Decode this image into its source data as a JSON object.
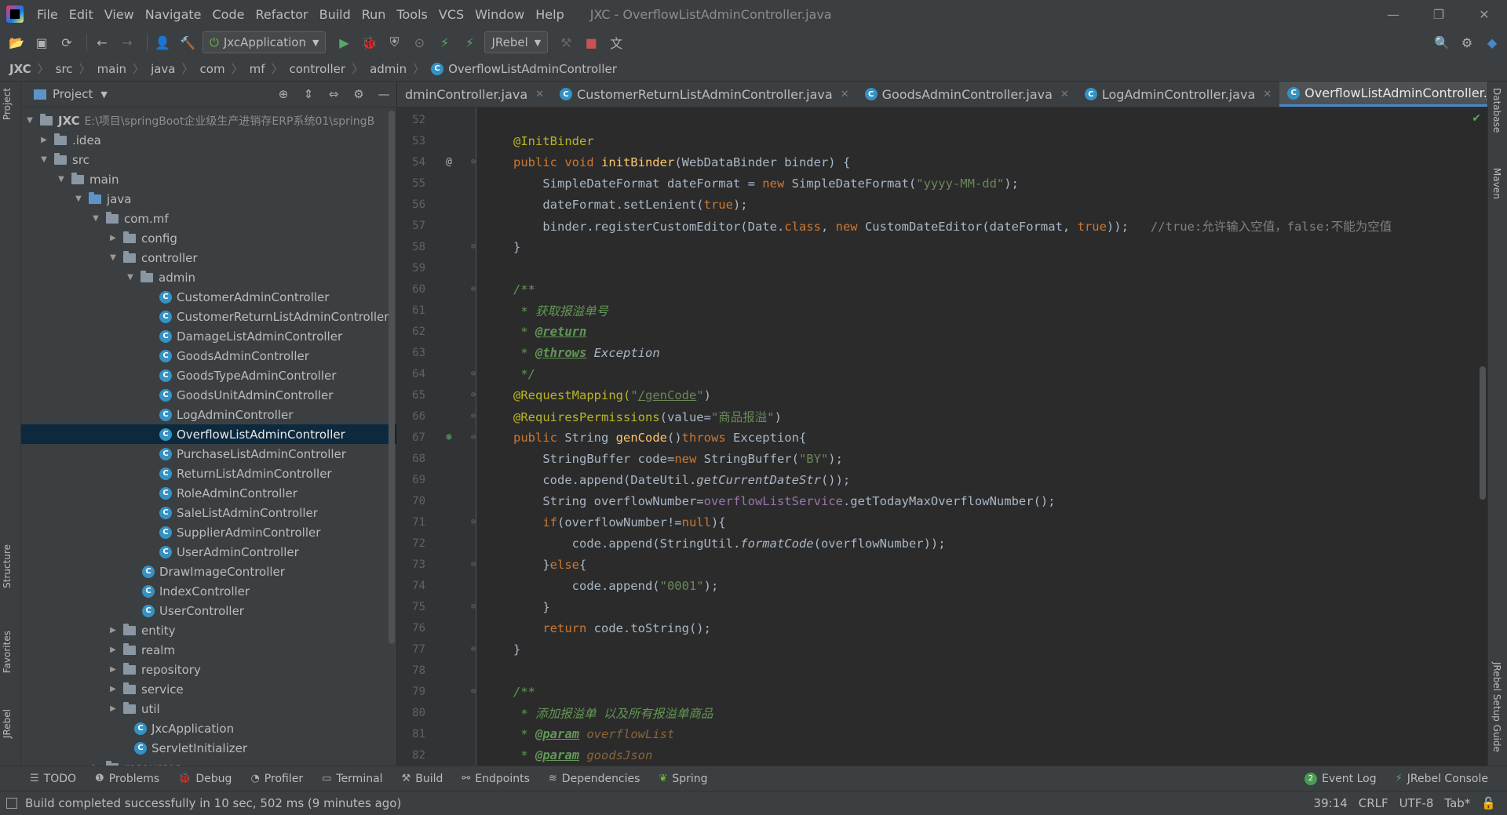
{
  "menu": [
    "File",
    "Edit",
    "View",
    "Navigate",
    "Code",
    "Refactor",
    "Build",
    "Run",
    "Tools",
    "VCS",
    "Window",
    "Help"
  ],
  "window_title": "JXC - OverflowListAdminController.java",
  "toolbar": {
    "run_config": "JxcApplication",
    "jrebel_label": "JRebel"
  },
  "breadcrumb": [
    "JXC",
    "src",
    "main",
    "java",
    "com",
    "mf",
    "controller",
    "admin",
    "OverflowListAdminController"
  ],
  "project": {
    "header": "Project",
    "root_name": "JXC",
    "root_path": "E:\\项目\\springBoot企业级生产进销存ERP系统01\\springB",
    "tree": [
      {
        "label": ".idea"
      },
      {
        "label": "src"
      },
      {
        "label": "main"
      },
      {
        "label": "java"
      },
      {
        "label": "com.mf"
      },
      {
        "label": "config"
      },
      {
        "label": "controller"
      },
      {
        "label": "admin"
      },
      {
        "label": "CustomerAdminController"
      },
      {
        "label": "CustomerReturnListAdminController"
      },
      {
        "label": "DamageListAdminController"
      },
      {
        "label": "GoodsAdminController"
      },
      {
        "label": "GoodsTypeAdminController"
      },
      {
        "label": "GoodsUnitAdminController"
      },
      {
        "label": "LogAdminController"
      },
      {
        "label": "OverflowListAdminController"
      },
      {
        "label": "PurchaseListAdminController"
      },
      {
        "label": "ReturnListAdminController"
      },
      {
        "label": "RoleAdminController"
      },
      {
        "label": "SaleListAdminController"
      },
      {
        "label": "SupplierAdminController"
      },
      {
        "label": "UserAdminController"
      },
      {
        "label": "DrawImageController"
      },
      {
        "label": "IndexController"
      },
      {
        "label": "UserController"
      },
      {
        "label": "entity"
      },
      {
        "label": "realm"
      },
      {
        "label": "repository"
      },
      {
        "label": "service"
      },
      {
        "label": "util"
      },
      {
        "label": "JxcApplication"
      },
      {
        "label": "ServletInitializer"
      },
      {
        "label": "resources"
      }
    ]
  },
  "tabs": [
    {
      "label": "dminController.java"
    },
    {
      "label": "CustomerReturnListAdminController.java"
    },
    {
      "label": "GoodsAdminController.java"
    },
    {
      "label": "LogAdminController.java"
    },
    {
      "label": "OverflowListAdminController.java"
    }
  ],
  "code": {
    "line_numbers": [
      "52",
      "53",
      "54",
      "55",
      "56",
      "57",
      "58",
      "59",
      "60",
      "61",
      "62",
      "63",
      "64",
      "65",
      "66",
      "67",
      "68",
      "69",
      "70",
      "71",
      "72",
      "73",
      "74",
      "75",
      "76",
      "77",
      "78",
      "79",
      "80",
      "81",
      "82"
    ],
    "l53": "@InitBinder",
    "l54_kw": "public void ",
    "l54_fn": "initBinder",
    "l54_rest": "(WebDataBinder binder) {",
    "l55_a": "SimpleDateFormat dateFormat = ",
    "l55_kw": "new ",
    "l55_b": "SimpleDateFormat(",
    "l55_str": "\"yyyy-MM-dd\"",
    "l55_c": ");",
    "l56_a": "dateFormat.setLenient(",
    "l56_kw": "true",
    "l56_b": ");",
    "l57_a": "binder.registerCustomEditor(Date.",
    "l57_kw1": "class",
    "l57_b": ", ",
    "l57_kw2": "new ",
    "l57_c": "CustomDateEditor(dateFormat, ",
    "l57_kw3": "true",
    "l57_d": "));",
    "l57_cmt": "   //true:允许输入空值，false:不能为空值",
    "l58": "}",
    "l60": "/**",
    "l61": " * 获取报溢单号",
    "l62_pre": " * ",
    "l62_tag": "@return",
    "l63_pre": " * ",
    "l63_tag": "@throws",
    "l63_rest": " Exception",
    "l64": " */",
    "l65_ann": "@RequestMapping(",
    "l65_str": "\"",
    "l65_url": "/genCode",
    "l65_str2": "\"",
    "l65_end": ")",
    "l66_ann": "@RequiresPermissions",
    "l66_a": "(value=",
    "l66_str": "\"商品报溢\"",
    "l66_b": ")",
    "l67_kw": "public ",
    "l67_a": "String ",
    "l67_fn": "genCode",
    "l67_b": "()",
    "l67_kw2": "throws ",
    "l67_c": "Exception{",
    "l68_a": "StringBuffer code=",
    "l68_kw": "new ",
    "l68_b": "StringBuffer(",
    "l68_str": "\"BY\"",
    "l68_c": ");",
    "l69_a": "code.append(DateUtil.",
    "l69_it": "getCurrentDateStr",
    "l69_b": "());",
    "l70_a": "String overflowNumber=",
    "l70_fld": "overflowListService",
    "l70_b": ".getTodayMaxOverflowNumber();",
    "l71_kw": "if",
    "l71_a": "(overflowNumber!=",
    "l71_kw2": "null",
    "l71_b": "){",
    "l72_a": "code.append(StringUtil.",
    "l72_it": "formatCode",
    "l72_b": "(overflowNumber));",
    "l73_a": "}",
    "l73_kw": "else",
    "l73_b": "{",
    "l74_a": "code.append(",
    "l74_str": "\"0001\"",
    "l74_b": ");",
    "l75": "}",
    "l76_kw": "return ",
    "l76_a": "code.toString();",
    "l77": "}",
    "l79": "/**",
    "l80": " * 添加报溢单 以及所有报溢单商品",
    "l81_pre": " * ",
    "l81_tag": "@param",
    "l81_rest": " overflowList",
    "l82_pre": " * ",
    "l82_tag": "@param",
    "l82_rest": " goodsJson"
  },
  "toolwindows": [
    "TODO",
    "Problems",
    "Debug",
    "Profiler",
    "Terminal",
    "Build",
    "Endpoints",
    "Dependencies",
    "Spring"
  ],
  "toolwindows_right": {
    "event_log": "Event Log",
    "event_count": "2",
    "jrebel_console": "JRebel Console"
  },
  "status": {
    "message": "Build completed successfully in 10 sec, 502 ms (9 minutes ago)",
    "position": "39:14",
    "line_sep": "CRLF",
    "encoding": "UTF-8",
    "indent": "Tab*"
  },
  "side_labels": {
    "project": "Project",
    "structure": "Structure",
    "favorites": "Favorites",
    "jrebel": "JRebel",
    "database": "Database",
    "maven": "Maven",
    "jrebel_guide": "JRebel Setup Guide"
  }
}
